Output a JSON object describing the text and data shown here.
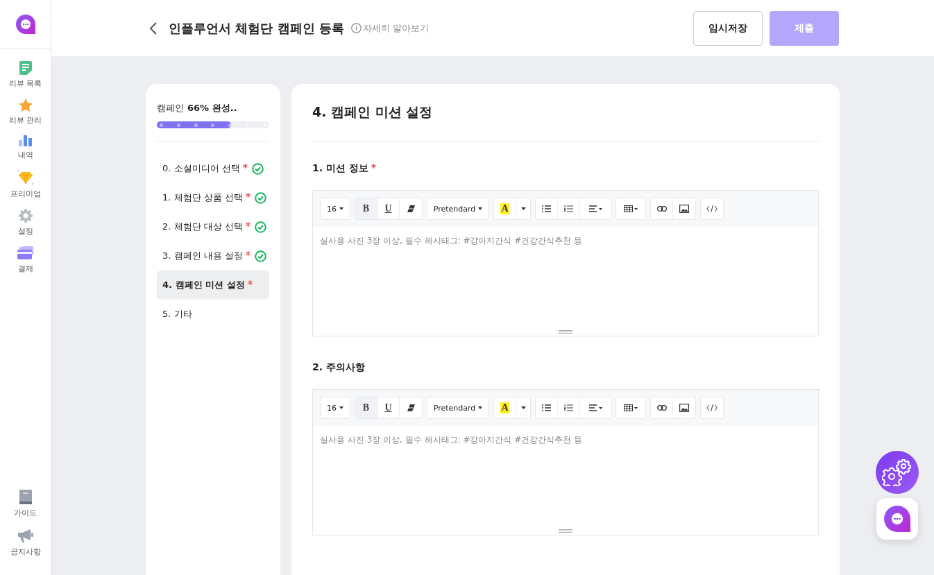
{
  "sidebar": {
    "items": [
      {
        "label": "리뷰 목록"
      },
      {
        "label": "리뷰 관리"
      },
      {
        "label": "내역"
      },
      {
        "label": "프리미엄"
      },
      {
        "label": "설정"
      },
      {
        "label": "결제"
      }
    ],
    "bottom_items": [
      {
        "label": "가이드"
      },
      {
        "label": "공지사항"
      }
    ]
  },
  "header": {
    "title": "인플루언서 체험단 캠페인 등록",
    "help_link": "자세히 알아보기",
    "buttons": [
      {
        "label": "임시저장",
        "kind": "outline",
        "disabled": false
      },
      {
        "label": "제출",
        "kind": "primary",
        "disabled": true
      }
    ]
  },
  "progress": {
    "label": "캠페인",
    "percent_text": "66% 완성..",
    "level": 0.66
  },
  "steps": [
    {
      "label": "0. 소셜미디어 선택",
      "required": true,
      "completed": true,
      "selected": false
    },
    {
      "label": "1. 체험단 상품 선택",
      "required": true,
      "completed": true,
      "selected": false
    },
    {
      "label": "2. 체험단 대상 선택",
      "required": true,
      "completed": true,
      "selected": false
    },
    {
      "label": "3. 캠페인 내용 설정",
      "required": true,
      "completed": true,
      "selected": false
    },
    {
      "label": "4. 캠페인 미션 설정",
      "required": true,
      "completed": false,
      "selected": true
    },
    {
      "label": "5. 기타",
      "required": false,
      "completed": false,
      "selected": false
    }
  ],
  "section": {
    "title": "4. 캠페인 미션 설정",
    "fields": [
      {
        "label": "1. 미션 정보",
        "required": true,
        "font_size": "16",
        "font": "Pretendard",
        "color_button": "A",
        "bold": "B",
        "underline": "U",
        "placeholder": "실사용 사진 3장 이상, 필수 해시태그: #강아지간식 #건강간식추천 등"
      },
      {
        "label": "2. 주의사항",
        "required": false,
        "font_size": "16",
        "font": "Pretendard",
        "color_button": "A",
        "bold": "B",
        "underline": "U",
        "placeholder": "실사용 사진 3장 이상, 필수 해시태그: #강아지간식 #건강간식추천 등"
      }
    ]
  }
}
